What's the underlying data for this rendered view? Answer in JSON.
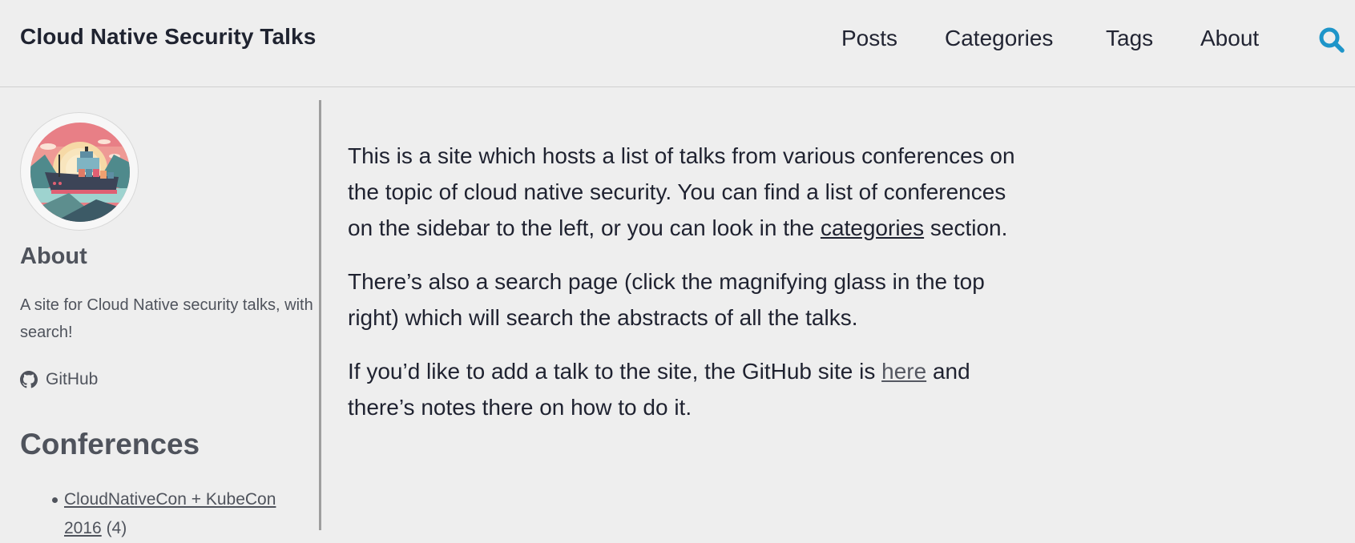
{
  "header": {
    "site_title": "Cloud Native Security Talks",
    "nav": [
      {
        "label": "Posts"
      },
      {
        "label": "Categories"
      },
      {
        "label": "Tags"
      },
      {
        "label": "About"
      }
    ],
    "search_icon": "search-icon",
    "accent_color": "#1e95c9"
  },
  "sidebar": {
    "avatar_alt": "Container ship illustration",
    "about_heading": "About",
    "about_text": "A site for Cloud Native security talks, with search!",
    "github_label": "GitHub",
    "github_icon": "github-icon",
    "conferences_heading": "Conferences",
    "conferences": [
      {
        "name": "CloudNativeCon + KubeCon 2016",
        "count": "(4)"
      }
    ]
  },
  "content": {
    "p1_before": "This is a site which hosts a list of talks from various conferences on the topic of cloud native security. You can find a list of conferences on the sidebar to the left, or you can look in the ",
    "p1_link": "categories",
    "p1_after": " section.",
    "p2": "There’s also a search page (click the magnifying glass in the top right) which will search the abstracts of all the talks.",
    "p3_before": "If you’d like to add a talk to the site, the GitHub site is ",
    "p3_link": "here",
    "p3_after": " and there’s notes there on how to do it."
  }
}
